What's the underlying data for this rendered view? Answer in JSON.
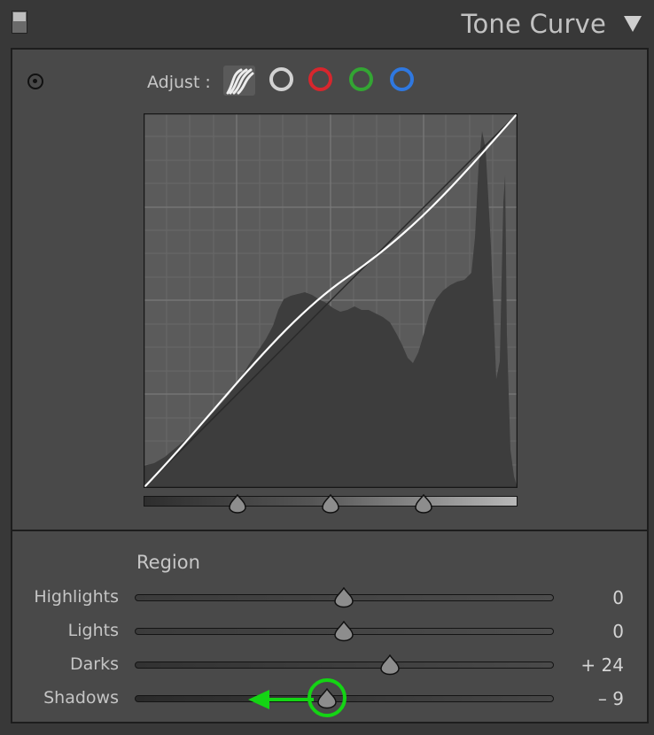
{
  "header": {
    "title": "Tone Curve",
    "toggle_icon": "panel-toggle-icon",
    "collapse_icon": "triangle-down-icon"
  },
  "curve": {
    "target_icon": "targeted-adjustment-icon",
    "adjust_label": "Adjust :",
    "channels": [
      {
        "name": "parametric",
        "icon": "parametric-curve-icon",
        "color": "#e6e6e6",
        "active": true
      },
      {
        "name": "rgb",
        "icon": "point-curve-rgb-icon",
        "color": "#d2d2d2"
      },
      {
        "name": "red",
        "icon": "red-channel-icon",
        "color": "#d7262d"
      },
      {
        "name": "green",
        "icon": "green-channel-icon",
        "color": "#33a533"
      },
      {
        "name": "blue",
        "icon": "blue-channel-icon",
        "color": "#2f78e0"
      }
    ],
    "split_points": [
      25,
      50,
      75
    ]
  },
  "region": {
    "title": "Region",
    "sliders": [
      {
        "label": "Highlights",
        "value": "0",
        "level": 0
      },
      {
        "label": "Lights",
        "value": "0",
        "level": 0
      },
      {
        "label": "Darks",
        "value": "+ 24",
        "level": 24
      },
      {
        "label": "Shadows",
        "value": "– 9",
        "level": -9,
        "highlighted": true
      }
    ]
  },
  "annotation": {
    "ring_color": "#14d414",
    "arrow_direction": "left"
  }
}
